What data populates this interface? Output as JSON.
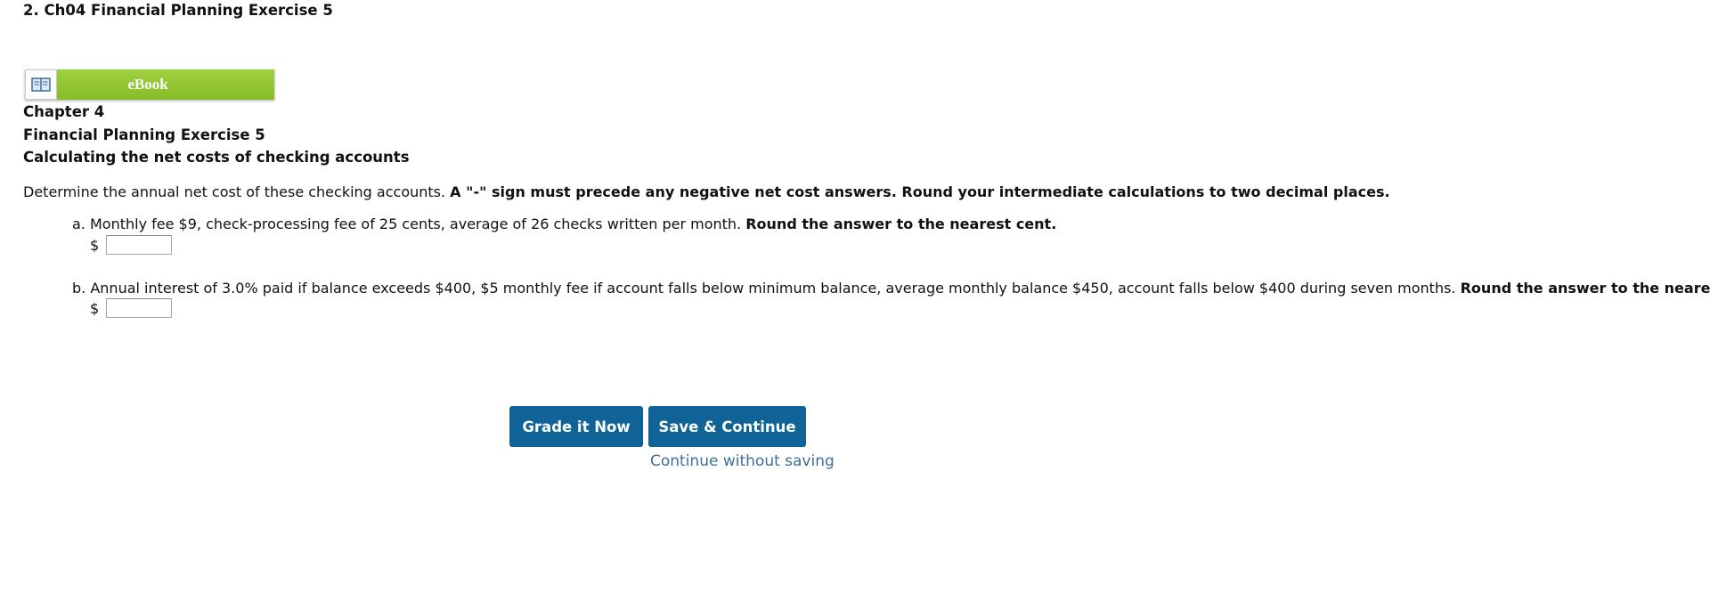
{
  "question": {
    "title": "2. Ch04 Financial Planning Exercise 5"
  },
  "ebook": {
    "icon": "open-book-icon",
    "label": "eBook"
  },
  "header": {
    "chapter": "Chapter 4",
    "exercise": "Financial Planning Exercise 5",
    "topic": "Calculating the net costs of checking accounts"
  },
  "instructions": {
    "text": "Determine the annual net cost of these checking accounts.",
    "bold": "A \"-\" sign must precede any negative net cost answers. Round your intermediate calculations to two decimal places."
  },
  "parts": [
    {
      "prefix": "a.",
      "text": "Monthly fee $9, check-processing fee of 25 cents, average of 26 checks written per month.",
      "bold": "Round the answer to the nearest cent.",
      "currency": "$",
      "value": ""
    },
    {
      "prefix": "b.",
      "text": "Annual interest of 3.0% paid if balance exceeds $400, $5 monthly fee if account falls below minimum balance, average monthly balance $450, account falls below $400 during seven months.",
      "bold": "Round the answer to the nearest cent.",
      "currency": "$",
      "value": ""
    }
  ],
  "actions": {
    "grade_label": "Grade it Now",
    "save_label": "Save & Continue",
    "continue_label": "Continue without saving"
  },
  "colors": {
    "ebook_green": "#8dc132",
    "button_blue": "#0f6397",
    "link_blue": "#3f6f96"
  }
}
